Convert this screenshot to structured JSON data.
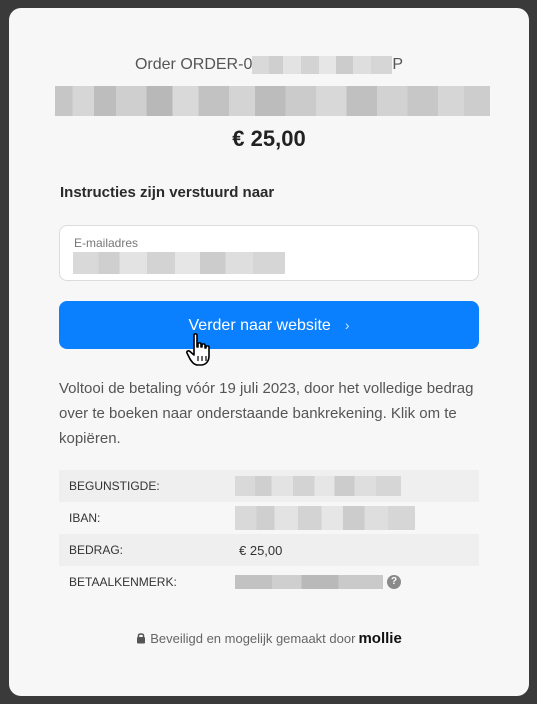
{
  "order": {
    "prefix": "Order ORDER-0",
    "suffix": "P"
  },
  "amount": "€ 25,00",
  "instructions_heading": "Instructies zijn verstuurd naar",
  "email": {
    "label": "E-mailadres"
  },
  "primary_button": {
    "label": "Verder naar website",
    "chevron": "›"
  },
  "info_text": "Voltooi de betaling vóór 19 juli 2023, door het volledige bedrag over te boeken naar onderstaande bankrekening. Klik om te kopiëren.",
  "bank_details": [
    {
      "key": "BEGUNSTIGDE:",
      "value": ""
    },
    {
      "key": "IBAN:",
      "value": ""
    },
    {
      "key": "BEDRAG:",
      "value": "€ 25,00"
    },
    {
      "key": "BETAALKENMERK:",
      "value": "",
      "help": "?"
    }
  ],
  "footer": {
    "text": "Beveiligd en mogelijk gemaakt door",
    "brand": "mollie"
  },
  "colors": {
    "accent": "#0a80ff",
    "background": "#f7f7f7"
  },
  "icons": {
    "lock": "lock-icon",
    "help": "help-icon",
    "cursor": "hand-pointer-icon",
    "chevron": "chevron-right-icon"
  }
}
